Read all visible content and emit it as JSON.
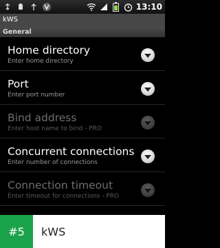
{
  "status_bar": {
    "time": "13:10",
    "left_icons": [
      "usb-icon",
      "android-debug-icon",
      "usb-icon",
      "app-notification-icon"
    ],
    "right_icons": [
      "wifi-icon",
      "signal-icon",
      "battery-icon",
      "alarm-icon"
    ]
  },
  "app": {
    "title": "kWS"
  },
  "category": {
    "label": "General"
  },
  "preferences": [
    {
      "title": "Home directory",
      "summary": "Enter home directory",
      "enabled": true
    },
    {
      "title": "Port",
      "summary": "Enter port number",
      "enabled": true
    },
    {
      "title": "Bind address",
      "summary": "Enter host name to bind - PRO",
      "enabled": false
    },
    {
      "title": "Concurrent connections",
      "summary": "Enter number of connections",
      "enabled": true
    },
    {
      "title": "Connection timeout",
      "summary": "Enter timeout for connections - PRO",
      "enabled": false
    }
  ],
  "banner": {
    "rank": "#5",
    "app_name": "kWS",
    "accent": "#1aa34a"
  }
}
